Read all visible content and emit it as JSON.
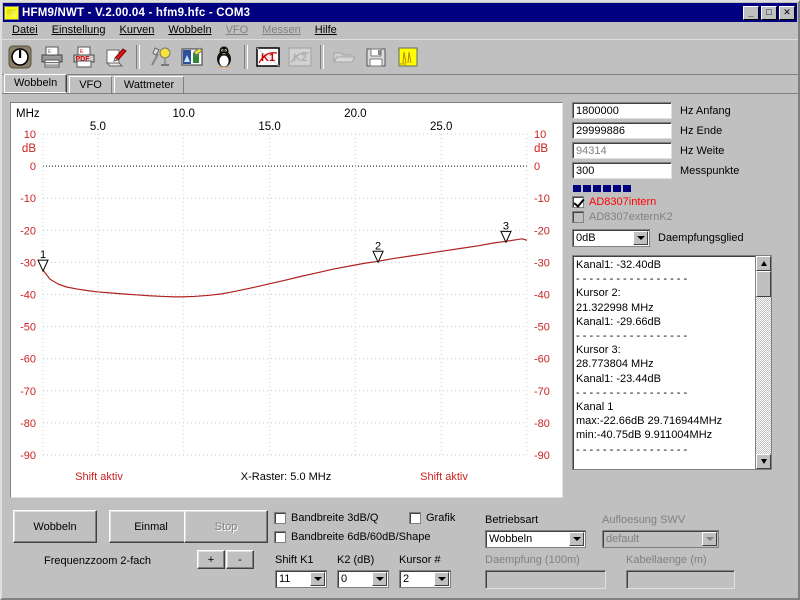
{
  "window": {
    "title": "HFM9/NWT - V.2.00.04 - hfm9.hfc - COM3",
    "minimize": "_",
    "maximize": "□",
    "close": "✕"
  },
  "menu": [
    {
      "label": "Datei",
      "enabled": true
    },
    {
      "label": "Einstellung",
      "enabled": true
    },
    {
      "label": "Kurven",
      "enabled": true
    },
    {
      "label": "Wobbeln",
      "enabled": true
    },
    {
      "label": "VFO",
      "enabled": false
    },
    {
      "label": "Messen",
      "enabled": false
    },
    {
      "label": "Hilfe",
      "enabled": true
    }
  ],
  "toolbar": [
    {
      "name": "power-icon"
    },
    {
      "name": "print-icon"
    },
    {
      "name": "pdf-export-icon"
    },
    {
      "name": "edit-note-icon"
    },
    {
      "name": "separator"
    },
    {
      "name": "calibrate-tools-icon"
    },
    {
      "name": "chart-image-icon"
    },
    {
      "name": "linux-penguin-icon"
    },
    {
      "name": "separator"
    },
    {
      "name": "k1-curve-icon"
    },
    {
      "name": "k2-curve-icon"
    },
    {
      "name": "separator"
    },
    {
      "name": "open-file-icon"
    },
    {
      "name": "save-disk-icon"
    },
    {
      "name": "notes-yellow-icon"
    }
  ],
  "tabs": [
    {
      "label": "Wobbeln",
      "active": true
    },
    {
      "label": "VFO",
      "active": false
    },
    {
      "label": "Wattmeter",
      "active": false
    }
  ],
  "chart_data": {
    "type": "line",
    "title": "",
    "xlabel": "MHz",
    "ylabel": "dB",
    "xlim": [
      1.8,
      30.0
    ],
    "ylim": [
      -90,
      10
    ],
    "grid": true,
    "x_raster_note": "X-Raster: 5.0 MHz",
    "shift_left_note": "Shift aktiv",
    "shift_right_note": "Shift aktiv",
    "unit_x": "MHz",
    "unit_y": "dB",
    "xticks": [
      "5.0",
      "10.0",
      "15.0",
      "20.0",
      "25.0"
    ],
    "xtick_values": [
      5.0,
      10.0,
      15.0,
      20.0,
      25.0
    ],
    "yticks": [
      "10",
      "0",
      "-10",
      "-20",
      "-30",
      "-40",
      "-50",
      "-60",
      "-70",
      "-80",
      "-90"
    ],
    "ytick_values": [
      10,
      0,
      -10,
      -20,
      -30,
      -40,
      -50,
      -60,
      -70,
      -80,
      -90
    ],
    "series": [
      {
        "name": "Kanal 1",
        "color": "#b02020",
        "x": [
          1.8,
          2.2,
          2.7,
          3.2,
          3.8,
          4.4,
          5.0,
          5.7,
          6.4,
          7.2,
          8.0,
          8.8,
          9.5,
          9.9,
          10.6,
          11.4,
          12.2,
          13.0,
          13.9,
          14.8,
          15.8,
          16.8,
          17.8,
          18.8,
          19.8,
          20.5,
          21.32,
          22.2,
          23.2,
          24.2,
          25.2,
          26.2,
          27.2,
          28.0,
          28.77,
          29.3,
          29.72,
          30.0
        ],
        "y": [
          -32.4,
          -35.2,
          -36.8,
          -37.7,
          -38.3,
          -38.8,
          -39.2,
          -39.5,
          -39.8,
          -40.1,
          -40.4,
          -40.6,
          -40.75,
          -40.75,
          -40.6,
          -40.3,
          -39.8,
          -39.0,
          -38.0,
          -36.9,
          -35.7,
          -34.4,
          -33.2,
          -32.0,
          -31.0,
          -30.3,
          -29.66,
          -28.8,
          -28.0,
          -27.2,
          -26.4,
          -25.6,
          -24.8,
          -24.0,
          -23.44,
          -23.0,
          -22.66,
          -23.1
        ]
      }
    ],
    "cursors": [
      {
        "id": "1",
        "x": 1.8,
        "y": -32.4,
        "label": "1"
      },
      {
        "id": "2",
        "x": 21.322998,
        "y": -29.66,
        "label": "2"
      },
      {
        "id": "3",
        "x": 28.773804,
        "y": -23.44,
        "label": "3"
      }
    ]
  },
  "settings": {
    "fields": [
      {
        "name": "hz-anfang",
        "value": "1800000",
        "label": "Hz Anfang",
        "readonly": false
      },
      {
        "name": "hz-ende",
        "value": "29999886",
        "label": "Hz Ende",
        "readonly": false
      },
      {
        "name": "hz-weite",
        "value": "94314",
        "label": "Hz Weite",
        "readonly": true
      },
      {
        "name": "messpunkte",
        "value": "300",
        "label": "Messpunkte",
        "readonly": false
      }
    ],
    "progress_segments": 6,
    "progress_color": "#000080",
    "checkboxes": [
      {
        "name": "ad8307intern",
        "label": "AD8307intern",
        "checked": true,
        "enabled": true,
        "color": "#ff0000"
      },
      {
        "name": "ad8307externk2",
        "label": "AD8307externK2",
        "checked": false,
        "enabled": false,
        "color": "#808080"
      }
    ],
    "attenuator": {
      "value": "0dB",
      "label": "Daempfungsglied"
    }
  },
  "log": {
    "lines": [
      "Kanal1: -32.40dB",
      "- - - - - - - - - - - - - - - - -",
      "Kursor 2:",
      "21.322998 MHz",
      "Kanal1: -29.66dB",
      "- - - - - - - - - - - - - - - - -",
      "Kursor 3:",
      "28.773804 MHz",
      "Kanal1: -23.44dB",
      "- - - - - - - - - - - - - - - - -",
      "Kanal 1",
      "max:-22.66dB 29.716944MHz",
      "min:-40.75dB 9.911004MHz",
      "- - - - - - - - - - - - - - - - -"
    ]
  },
  "bottom": {
    "wobbeln_button": "Wobbeln",
    "einmal_button": "Einmal",
    "stop_button": "Stop",
    "stop_enabled": false,
    "zoom_label": "Frequenzzoom 2-fach",
    "zoom_plus": "+",
    "zoom_minus": "-",
    "checkboxes": [
      {
        "name": "bandbreite-3db-q",
        "label": "Bandbreite 3dB/Q",
        "checked": false
      },
      {
        "name": "bandbreite-6db-60db-shape",
        "label": "Bandbreite 6dB/60dB/Shape",
        "checked": false
      },
      {
        "name": "grafik",
        "label": "Grafik",
        "checked": false
      }
    ],
    "shift_k1": {
      "label": "Shift K1",
      "value": "11"
    },
    "k2_db": {
      "label": "K2 (dB)",
      "value": "0"
    },
    "kursor_num": {
      "label": "Kursor #",
      "value": "2"
    },
    "betriebsart": {
      "label": "Betriebsart",
      "value": "Wobbeln",
      "enabled": true
    },
    "aufloesung": {
      "label": "Aufloesung SWV",
      "value": "default",
      "enabled": false
    },
    "daempfung": {
      "label": "Daempfung (100m)",
      "value": "",
      "enabled": false
    },
    "kabellaenge": {
      "label": "Kabellaenge (m)",
      "value": "",
      "enabled": false
    }
  }
}
